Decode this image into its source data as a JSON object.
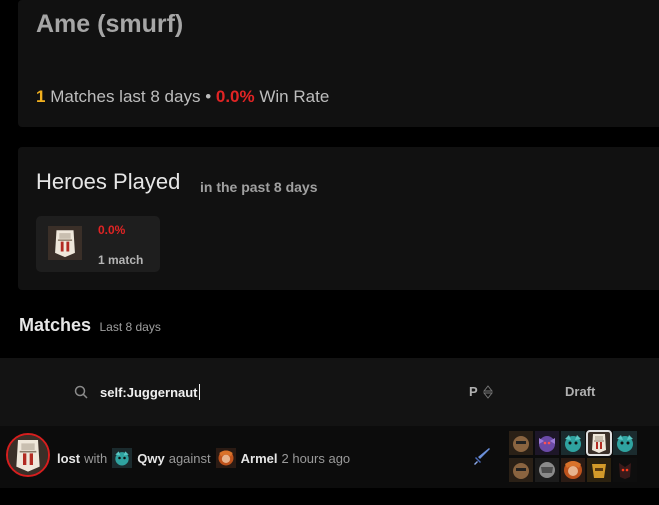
{
  "profile": {
    "name": "Ame (smurf)",
    "matches_count": "1",
    "matches_label": "Matches last 8 days",
    "separator": "•",
    "win_rate": "0.0%",
    "win_rate_label": "Win Rate"
  },
  "heroes_played": {
    "title": "Heroes Played",
    "subtitle": "in the past 8 days",
    "heroes": [
      {
        "icon": "juggernaut-portrait-icon",
        "win_rate": "0.0%",
        "matches": "1 match"
      }
    ]
  },
  "matches": {
    "title": "Matches",
    "subtitle": "Last 8 days",
    "search": {
      "value": "self:Juggernaut",
      "icon": "search-icon"
    },
    "columns": {
      "p": "P",
      "draft": "Draft"
    },
    "rows": [
      {
        "result": "lost",
        "with_word": "with",
        "ally": "Qwy",
        "against_word": "against",
        "enemy": "Armel",
        "time": "2 hours ago",
        "role_icon": "sword-icon"
      }
    ]
  },
  "colors": {
    "accent_gold": "#f2b01e",
    "loss_red": "#e02424",
    "card_bg": "#111111"
  }
}
